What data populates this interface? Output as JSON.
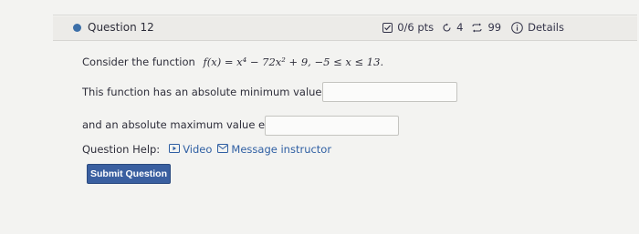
{
  "question": {
    "title": "Question 12",
    "pts": "0/6 pts",
    "retries": "4",
    "attempts": "99",
    "details_label": "Details"
  },
  "problem": {
    "intro": "Consider the function",
    "function": "f(x) = x⁴ − 72x² + 9,   −5 ≤ x ≤ 13.",
    "min_label": "This function has an absolute minimum value equal to",
    "max_label": "and an absolute maximum value equal to",
    "min_value": "",
    "max_value": ""
  },
  "help": {
    "label": "Question Help:",
    "video": "Video",
    "message": "Message instructor"
  },
  "submit_label": "Submit Question",
  "icons": {
    "pts": "checkbox-icon",
    "retries": "refresh-icon",
    "attempts": "sync-icon",
    "details": "info-icon",
    "video": "video-icon",
    "message": "mail-icon"
  },
  "colors": {
    "accent": "#3c6fa8",
    "button": "#3a5fa0",
    "link": "#2f5fa3"
  }
}
